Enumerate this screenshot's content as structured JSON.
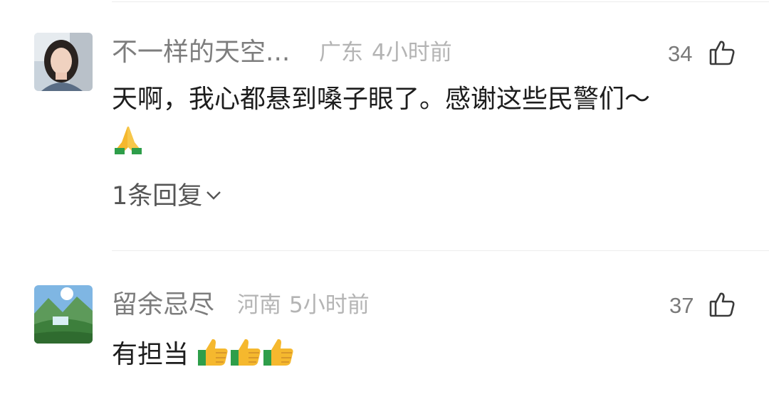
{
  "comments": [
    {
      "username": "不一样的天空...",
      "location": "广东",
      "time": "4小时前",
      "likes": "34",
      "text": "天啊，我心都悬到嗓子眼了。感谢这些民警们～",
      "emoji": "folded-hands-emoji",
      "replies_label": "1条回复"
    },
    {
      "username": "留余忌尽",
      "location": "河南",
      "time": "5小时前",
      "likes": "37",
      "text": "有担当",
      "emoji": "thumbs-up-emoji"
    }
  ],
  "icons": {
    "like": "thumbs-up-outline-icon",
    "expand": "chevron-down-icon"
  },
  "colors": {
    "username": "#7d7d7d",
    "meta": "#b4b4b4",
    "text": "#1d1d1d",
    "divider": "#ececec"
  }
}
